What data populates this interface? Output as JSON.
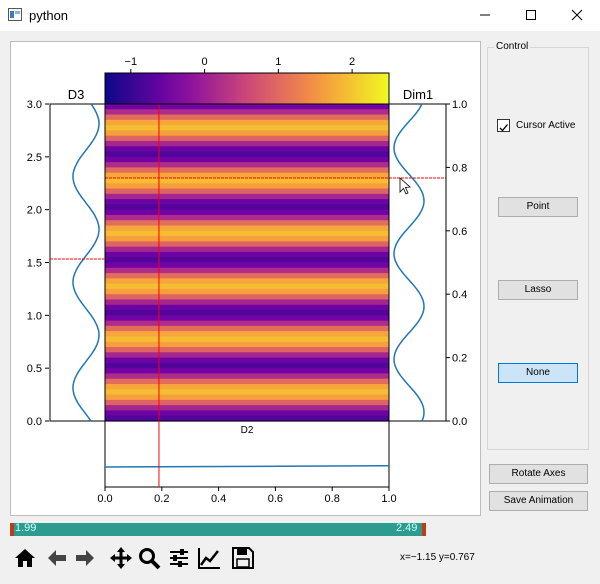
{
  "window": {
    "title": "python"
  },
  "control": {
    "group_label": "Control",
    "cursor_active_label": "Cursor Active",
    "cursor_active_checked": true,
    "point_label": "Point",
    "lasso_label": "Lasso",
    "none_label": "None",
    "rotate_axes_label": "Rotate Axes",
    "save_animation_label": "Save Animation"
  },
  "slider": {
    "min_label": "1.99",
    "max_label": "2.49"
  },
  "status": {
    "coords": "x=−1.15 y=0.767"
  },
  "toolbar": [
    "home-icon",
    "back-arrow-icon",
    "forward-arrow-icon",
    "pan-icon",
    "zoom-icon",
    "configure-subplots-icon",
    "edit-axis-icon",
    "save-icon"
  ],
  "colors": {
    "slider": "#2c9c91",
    "slider_handle": "#c23a16",
    "line": "#1f77b4",
    "cursor": "#ff0000"
  },
  "chart_data": [
    {
      "type": "heatmap",
      "colormap": "plasma",
      "title": "",
      "xlabel": "",
      "ylabel": "",
      "xlim": [
        0.0,
        1.0
      ],
      "ylim": [
        0.0,
        3.0
      ],
      "y_ticks": [
        "0.0",
        "0.5",
        "1.0",
        "1.5",
        "2.0",
        "2.5",
        "3.0"
      ],
      "pattern": "horizontal sinusoidal bands, about 6 periods over y 0–3",
      "cursor_x": 0.19,
      "cursor_y": 2.3
    },
    {
      "type": "colorbar",
      "range": [
        -1.35,
        2.5
      ],
      "ticks": [
        "−1",
        "0",
        "1",
        "2"
      ]
    },
    {
      "type": "line",
      "label": "D3",
      "xlabel": "",
      "ylabel": "",
      "description": "sine profile vs y",
      "cursor_y": 1.52
    },
    {
      "type": "line",
      "label": "Dim1",
      "ylim": [
        0.0,
        1.0
      ],
      "y_ticks": [
        "0.0",
        "0.2",
        "0.4",
        "0.6",
        "0.8",
        "1.0"
      ],
      "description": "sine profile",
      "cursor_y": 0.767
    },
    {
      "type": "line",
      "label": "D2",
      "xlim": [
        0.0,
        1.0
      ],
      "x_ticks": [
        "0.0",
        "0.2",
        "0.4",
        "0.6",
        "0.8",
        "1.0"
      ],
      "x": [
        0.0,
        1.0
      ],
      "y": [
        0.5,
        0.52
      ],
      "cursor_x": 0.19
    }
  ]
}
